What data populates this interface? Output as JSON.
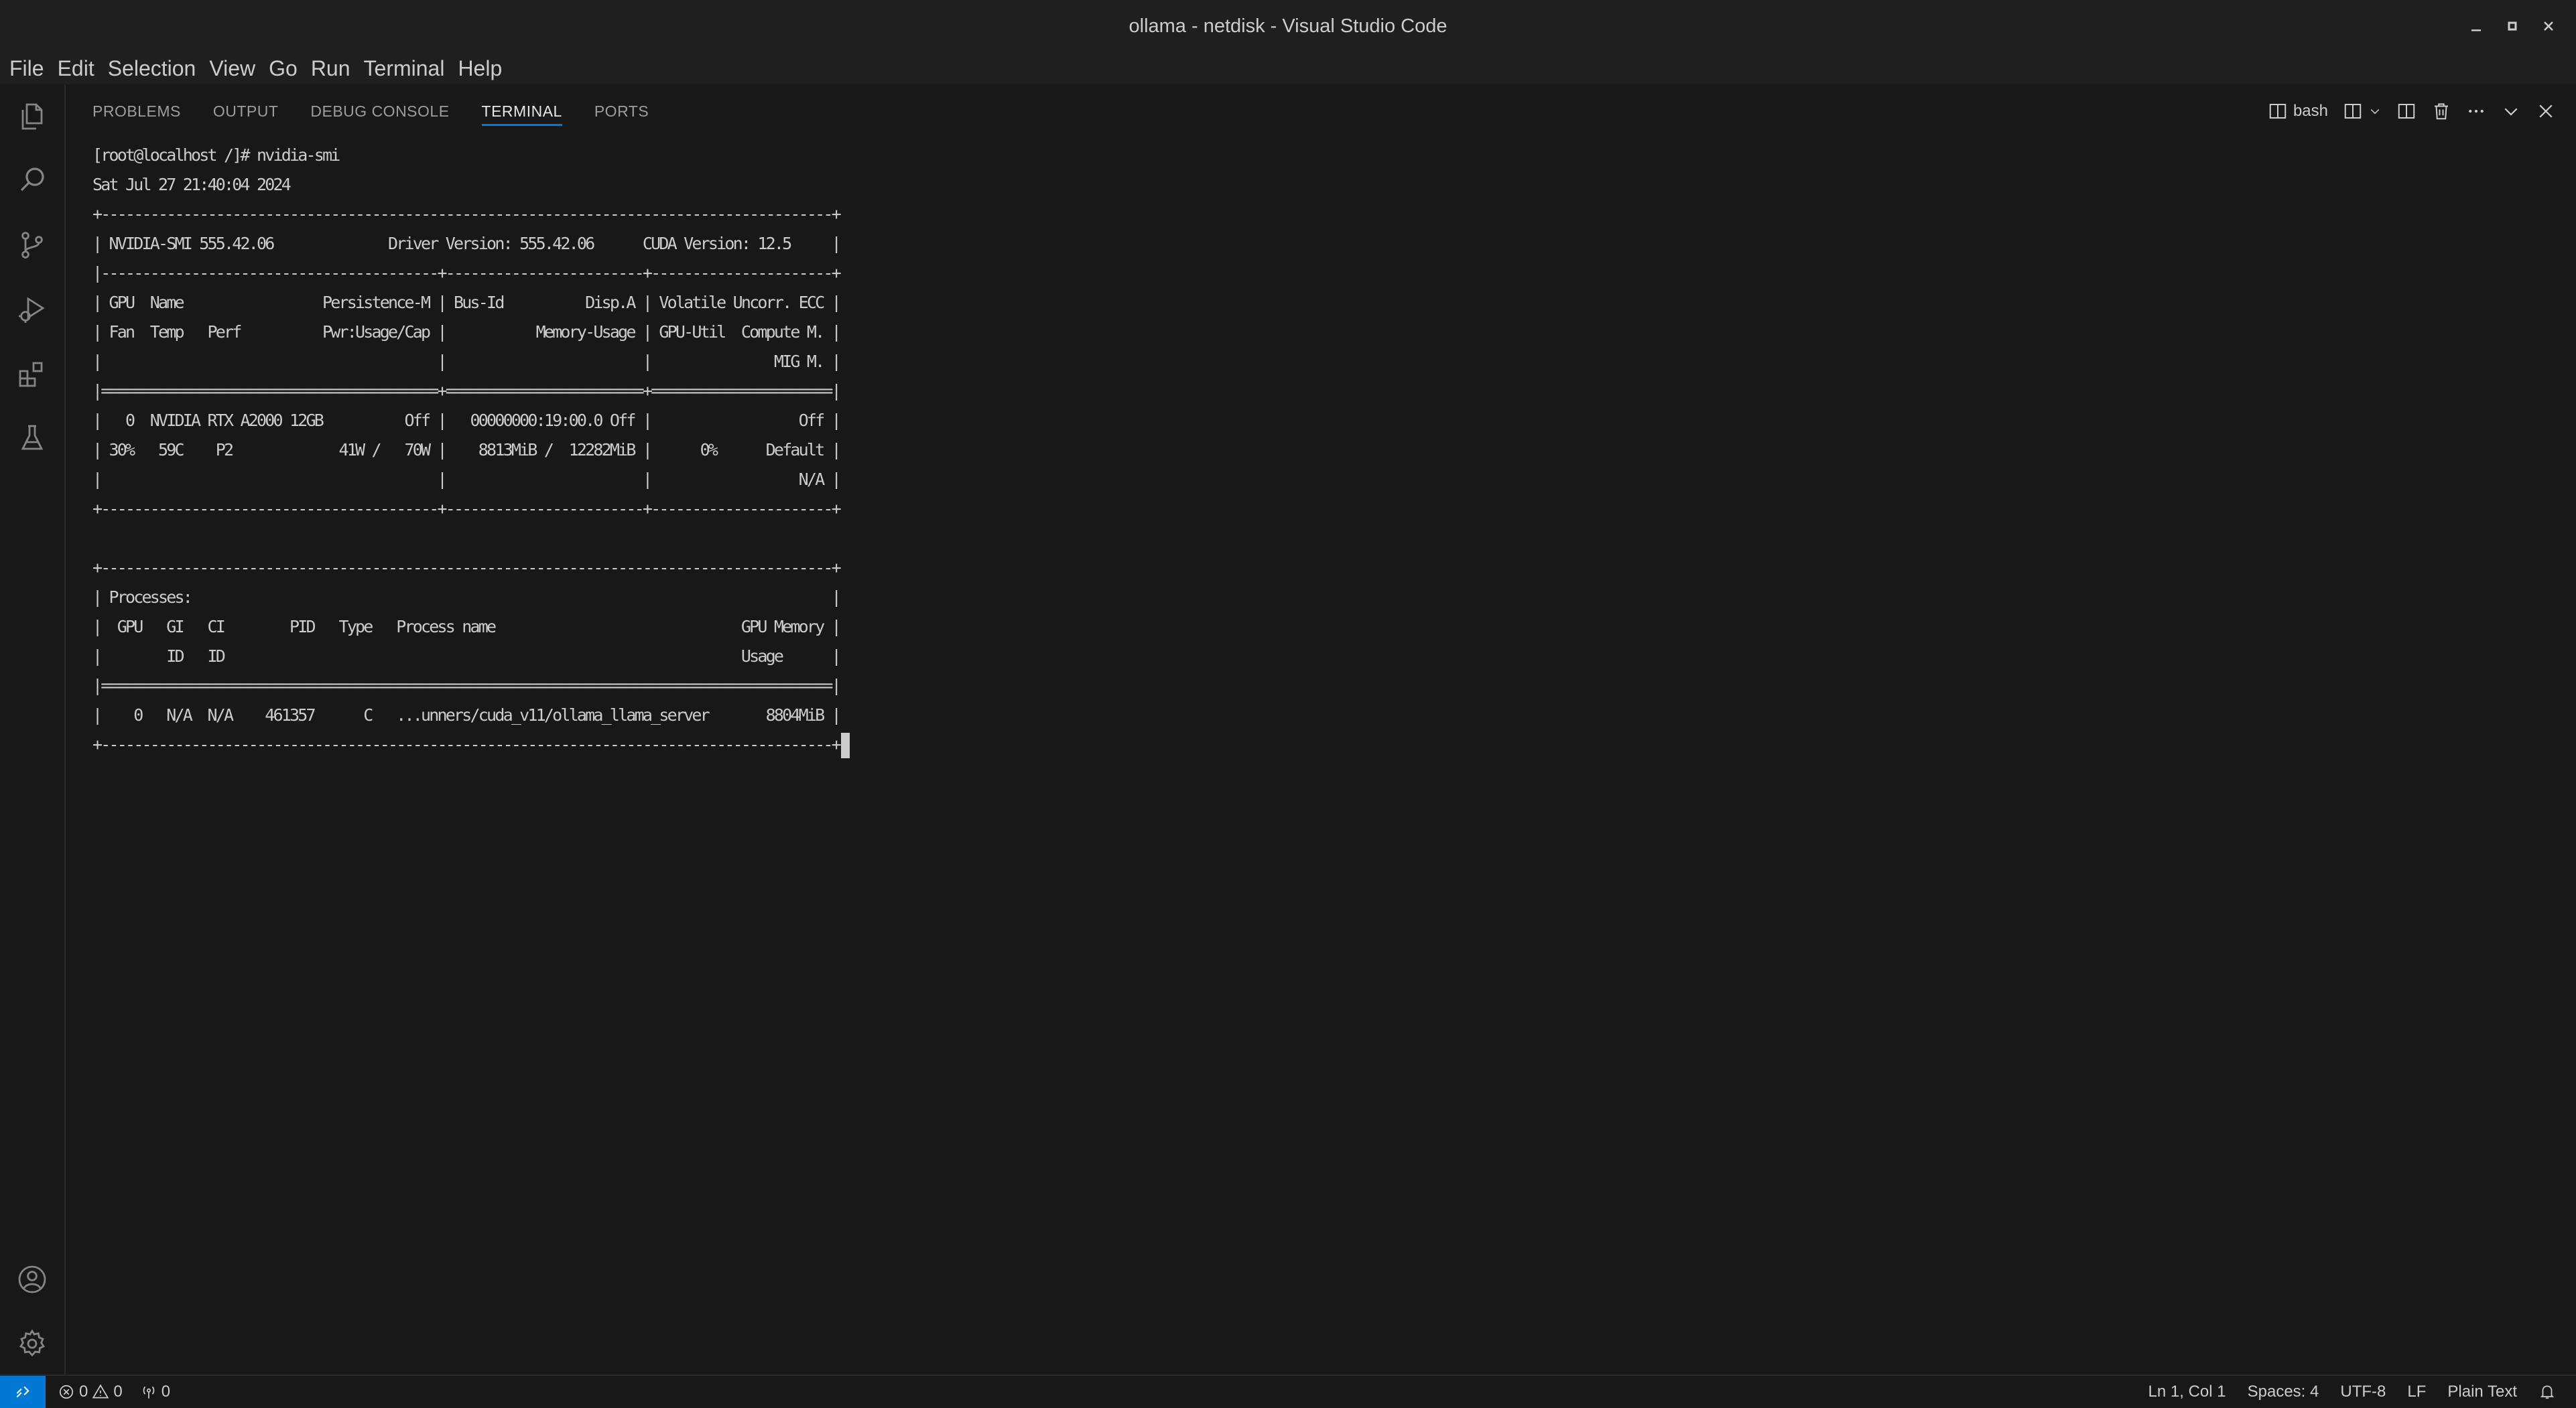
{
  "window": {
    "title": "ollama - netdisk - Visual Studio Code",
    "controls": [
      "minimize-icon",
      "maximize-icon",
      "close-icon"
    ]
  },
  "menu": [
    "File",
    "Edit",
    "Selection",
    "View",
    "Go",
    "Run",
    "Terminal",
    "Help"
  ],
  "activity_bar": {
    "top": [
      "explorer-icon",
      "search-icon",
      "source-control-icon",
      "run-debug-icon",
      "extensions-icon",
      "testing-icon"
    ],
    "bottom": [
      "accounts-icon",
      "settings-gear-icon"
    ]
  },
  "panel": {
    "tabs": [
      "PROBLEMS",
      "OUTPUT",
      "DEBUG CONSOLE",
      "TERMINAL",
      "PORTS"
    ],
    "active_tab": "TERMINAL",
    "terminal_name": "bash"
  },
  "terminal": {
    "lines": [
      "[root@localhost /]# nvidia-smi",
      "Sat Jul 27 21:40:04 2024",
      "+-----------------------------------------------------------------------------------------+",
      "| NVIDIA-SMI 555.42.06              Driver Version: 555.42.06      CUDA Version: 12.5     |",
      "|-----------------------------------------+------------------------+----------------------+",
      "| GPU  Name                 Persistence-M | Bus-Id          Disp.A | Volatile Uncorr. ECC |",
      "| Fan  Temp   Perf          Pwr:Usage/Cap |           Memory-Usage | GPU-Util  Compute M. |",
      "|                                         |                        |               MIG M. |",
      "|=========================================+========================+======================|",
      "|   0  NVIDIA RTX A2000 12GB          Off |   00000000:19:00.0 Off |                  Off |",
      "| 30%   59C    P2             41W /   70W |    8813MiB /  12282MiB |      0%      Default |",
      "|                                         |                        |                  N/A |",
      "+-----------------------------------------+------------------------+----------------------+",
      "",
      "+-----------------------------------------------------------------------------------------+",
      "| Processes:                                                                              |",
      "|  GPU   GI   CI        PID   Type   Process name                              GPU Memory |",
      "|        ID   ID                                                               Usage      |",
      "|=========================================================================================|",
      "|    0   N/A  N/A    461357      C   ...unners/cuda_v11/ollama_llama_server       8804MiB |",
      "+-----------------------------------------------------------------------------------------+"
    ]
  },
  "status_bar": {
    "errors": "0",
    "warnings": "0",
    "ports": "0",
    "position": "Ln 1, Col 1",
    "spaces": "Spaces: 4",
    "encoding": "UTF-8",
    "eol": "LF",
    "language": "Plain Text"
  },
  "colors": {
    "accent": "#0078d4",
    "background": "#1f1f1f",
    "panel": "#181818",
    "text": "#cccccc"
  }
}
